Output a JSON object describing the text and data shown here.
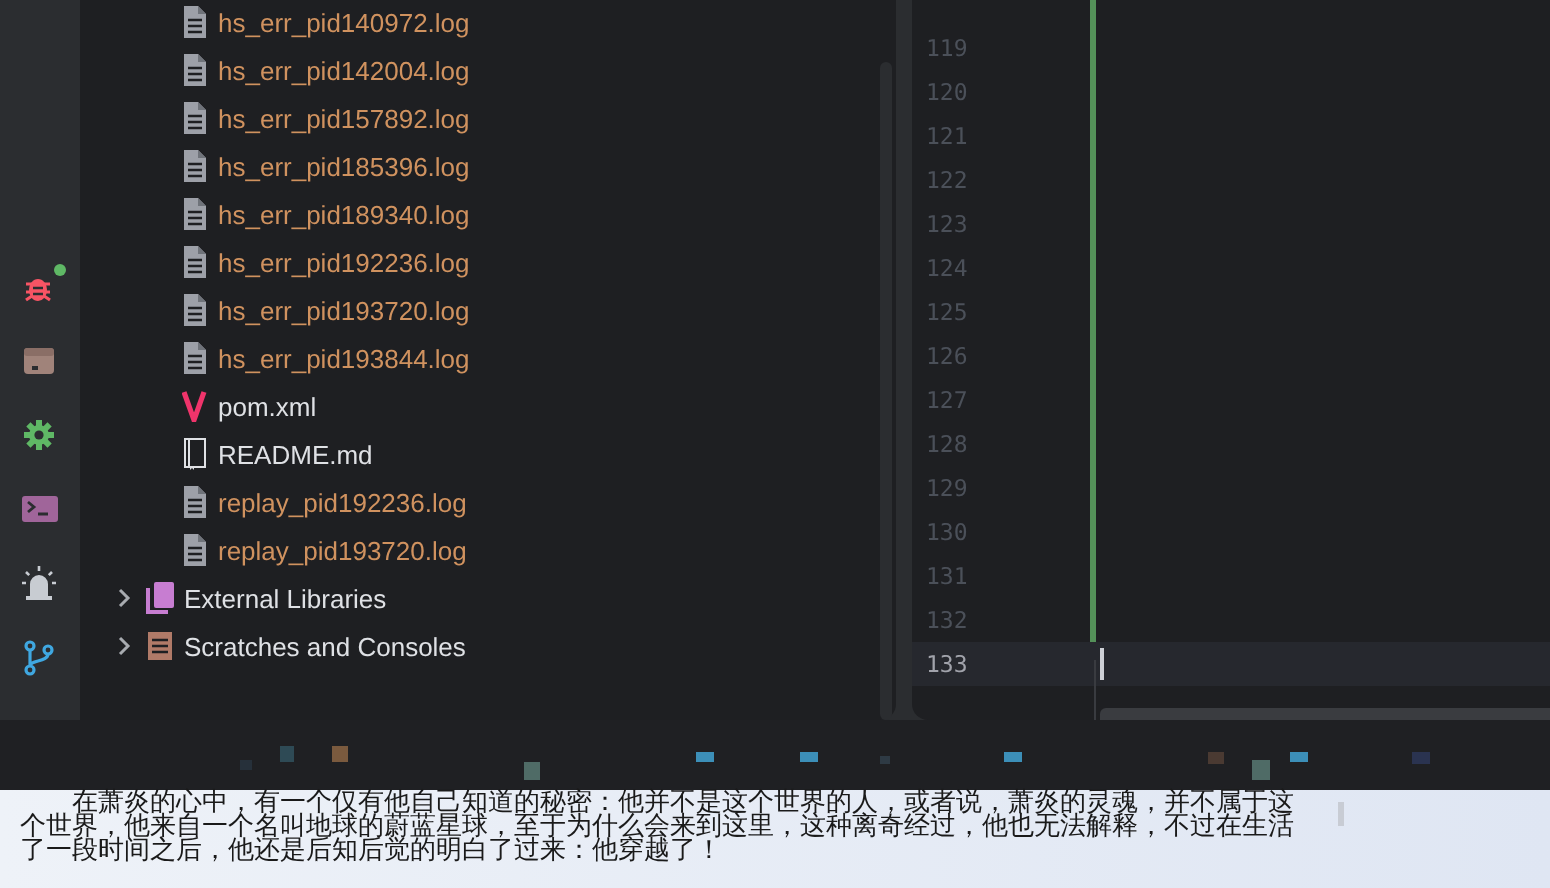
{
  "activity_bar": {
    "items": [
      {
        "kind": "debug",
        "badge": true
      },
      {
        "kind": "services",
        "badge": false
      },
      {
        "kind": "settings",
        "badge": false
      },
      {
        "kind": "terminal",
        "badge": false
      },
      {
        "kind": "alarm",
        "badge": false
      },
      {
        "kind": "git",
        "badge": false
      }
    ]
  },
  "project_tree": {
    "files": [
      {
        "label": "hs_err_pid140972.log",
        "kind": "log",
        "color": "#d0925f"
      },
      {
        "label": "hs_err_pid142004.log",
        "kind": "log",
        "color": "#d0925f"
      },
      {
        "label": "hs_err_pid157892.log",
        "kind": "log",
        "color": "#d0925f"
      },
      {
        "label": "hs_err_pid185396.log",
        "kind": "log",
        "color": "#d0925f"
      },
      {
        "label": "hs_err_pid189340.log",
        "kind": "log",
        "color": "#d0925f"
      },
      {
        "label": "hs_err_pid192236.log",
        "kind": "log",
        "color": "#d0925f"
      },
      {
        "label": "hs_err_pid193720.log",
        "kind": "log",
        "color": "#d0925f"
      },
      {
        "label": "hs_err_pid193844.log",
        "kind": "log",
        "color": "#d0925f"
      },
      {
        "label": "pom.xml",
        "kind": "maven",
        "color": "#dfe1e5"
      },
      {
        "label": "README.md",
        "kind": "markdown",
        "color": "#dfe1e5"
      },
      {
        "label": "replay_pid192236.log",
        "kind": "log",
        "color": "#d0925f"
      },
      {
        "label": "replay_pid193720.log",
        "kind": "log",
        "color": "#d0925f"
      }
    ],
    "nodes": [
      {
        "label": "External Libraries",
        "kind": "libraries",
        "expanded": false
      },
      {
        "label": "Scratches and Consoles",
        "kind": "scratches",
        "expanded": false
      }
    ]
  },
  "editor": {
    "lines": [
      {
        "number": "119",
        "changed": true,
        "selected": false
      },
      {
        "number": "120",
        "changed": true,
        "selected": false
      },
      {
        "number": "121",
        "changed": true,
        "selected": false
      },
      {
        "number": "122",
        "changed": true,
        "selected": false
      },
      {
        "number": "123",
        "changed": true,
        "selected": false
      },
      {
        "number": "124",
        "changed": true,
        "selected": false
      },
      {
        "number": "125",
        "changed": true,
        "selected": false
      },
      {
        "number": "126",
        "changed": true,
        "selected": false
      },
      {
        "number": "127",
        "changed": true,
        "selected": false
      },
      {
        "number": "128",
        "changed": true,
        "selected": false
      },
      {
        "number": "129",
        "changed": true,
        "selected": false
      },
      {
        "number": "130",
        "changed": true,
        "selected": false
      },
      {
        "number": "131",
        "changed": true,
        "selected": false
      },
      {
        "number": "132",
        "changed": true,
        "selected": false
      },
      {
        "number": "133",
        "changed": false,
        "selected": true
      }
    ]
  },
  "reader": {
    "text": "在萧炎的心中，有一个仅有他自己知道的秘密：他并不是这个世界的人，或者说，萧炎的灵魂，并不属于这个世界，他来自一个名叫地球的蔚蓝星球，至于为什么会来到这里，这种离奇经过，他也无法解释，不过在生活了一段时间之后，他还是后知后觉的明白了过来：他穿越了！"
  }
}
